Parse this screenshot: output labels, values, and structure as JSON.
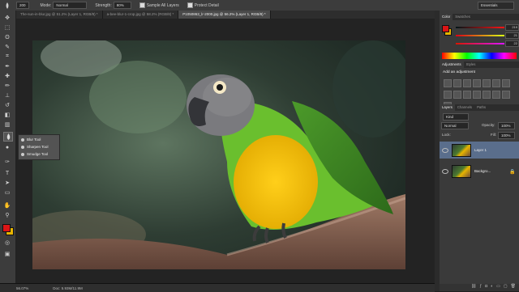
{
  "options_bar": {
    "mode_label": "Mode:",
    "mode_value": "Normal",
    "strength_label": "Strength:",
    "strength_value": "80%",
    "brush_size": "200",
    "sample_all_layers": "Sample All Layers",
    "protect_detail": "Protect Detail",
    "workspace": "Essentials"
  },
  "tabs": [
    "The-sun-in-blur.jpg @ 51.2% (Layer 1, RGB/8) *",
    "a-bee-blur-1-crop.jpg @ 58.2% (RGB/8) *",
    "P1050863_lr-2000.jpg @ 56.2% (Layer 1, RGB/8) *"
  ],
  "flyout": {
    "items": [
      "Blur Tool",
      "Sharpen Tool",
      "Smudge Tool"
    ]
  },
  "status": {
    "zoom": "56.07%",
    "doc": "Doc: 5.93M/11.9M"
  },
  "color_panel": {
    "tabs": [
      "Color",
      "Swatches"
    ],
    "r": "219",
    "g": "21",
    "b": "22"
  },
  "adjustments_panel": {
    "tabs": [
      "Adjustments",
      "Styles"
    ],
    "heading": "Add an adjustment"
  },
  "layers_panel": {
    "tabs": [
      "Layers",
      "Channels",
      "Paths"
    ],
    "kind": "Kind",
    "blend_mode": "Normal",
    "opacity_label": "Opacity:",
    "opacity_value": "100%",
    "lock_label": "Lock:",
    "fill_label": "Fill:",
    "fill_value": "100%",
    "layers": [
      "Layer 1",
      "Backgro..."
    ]
  },
  "colors": {
    "foreground": "#db1516",
    "background": "#e8b400",
    "accent": "#4a6fa8"
  }
}
